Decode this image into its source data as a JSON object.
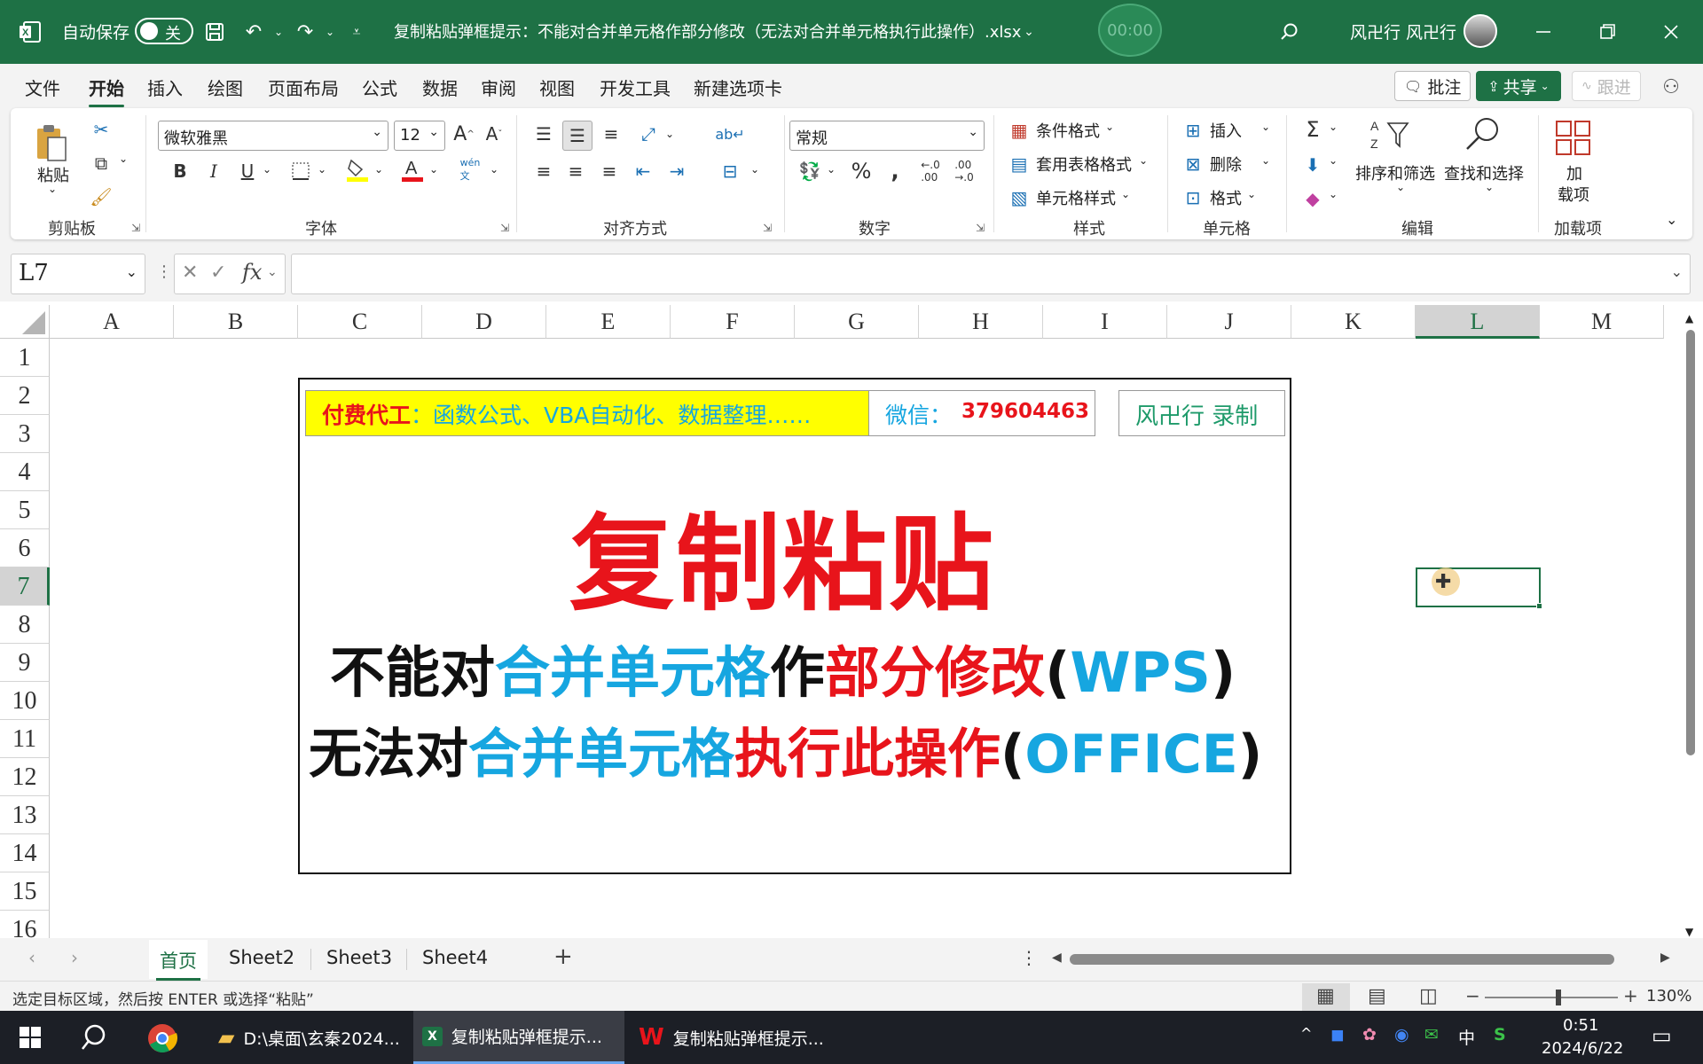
{
  "titlebar": {
    "autosave_label": "自动保存",
    "autosave_state": "关",
    "document_title": "复制粘贴弹框提示：不能对合并单元格作部分修改（无法对合并单元格执行此操作）.xlsx",
    "timer": "00:00",
    "user_name": "风卍行 风卍行"
  },
  "menu": {
    "items": [
      "文件",
      "开始",
      "插入",
      "绘图",
      "页面布局",
      "公式",
      "数据",
      "审阅",
      "视图",
      "开发工具",
      "新建选项卡"
    ],
    "comment_button": "批注",
    "share_button": "共享",
    "follow_button": "跟进"
  },
  "ribbon": {
    "clipboard": {
      "paste": "粘贴",
      "group": "剪贴板"
    },
    "font": {
      "family": "微软雅黑",
      "size": "12",
      "group": "字体",
      "bold": "B",
      "italic": "I",
      "underline": "U"
    },
    "alignment": {
      "group": "对齐方式"
    },
    "number": {
      "format": "常规",
      "group": "数字"
    },
    "styles": {
      "conditional": "条件格式",
      "table": "套用表格格式",
      "cell_styles": "单元格样式",
      "group": "样式"
    },
    "cells": {
      "insert": "插入",
      "delete": "删除",
      "format": "格式",
      "group": "单元格"
    },
    "editing": {
      "sort": "排序和筛选",
      "find": "查找和选择",
      "group": "编辑"
    },
    "addins": {
      "button_line1": "加",
      "button_line2": "载项",
      "group": "加载项"
    }
  },
  "formula_bar": {
    "name_box": "L7",
    "fx": "fx",
    "content": ""
  },
  "grid": {
    "columns": [
      "A",
      "B",
      "C",
      "D",
      "E",
      "F",
      "G",
      "H",
      "I",
      "J",
      "K",
      "L",
      "M"
    ],
    "rows": [
      "1",
      "2",
      "3",
      "4",
      "5",
      "6",
      "7",
      "8",
      "9",
      "10",
      "11",
      "12",
      "13",
      "14",
      "15",
      "16"
    ],
    "selected_column": "L",
    "selected_row": "7"
  },
  "banner": {
    "paid_label": "付费代工",
    "paid_desc": "：函数公式、VBA自动化、数据整理……",
    "wechat_label": "微信：",
    "wechat_id": "379604463",
    "recorder": "风卍行 录制",
    "headline": "复制粘贴",
    "line1": {
      "a": "不能对",
      "b": "合并单元格",
      "c": "作",
      "d": "部分修改",
      "e": "(",
      "f": "WPS",
      "g": ")"
    },
    "line2": {
      "a": "无法对",
      "b": "合并单元格",
      "c": "执行此操作",
      "d": "(",
      "e": "OFFICE",
      "f": ")"
    },
    "colors": {
      "red": "#e8141b",
      "blue": "#16a6e0",
      "black": "#111111",
      "yellow": "#ffff00",
      "green": "#1e7145"
    }
  },
  "sheets": {
    "tabs": [
      "首页",
      "Sheet2",
      "Sheet3",
      "Sheet4"
    ],
    "active": "首页",
    "add": "+"
  },
  "status": {
    "message": "选定目标区域，然后按 ENTER 或选择“粘贴”",
    "zoom": "130%"
  },
  "taskbar": {
    "apps": [
      "D:\\桌面\\玄秦2024...",
      "复制粘贴弹框提示...",
      "复制粘贴弹框提示..."
    ],
    "time": "0:51",
    "date": "2024/6/22",
    "ime": "中"
  }
}
